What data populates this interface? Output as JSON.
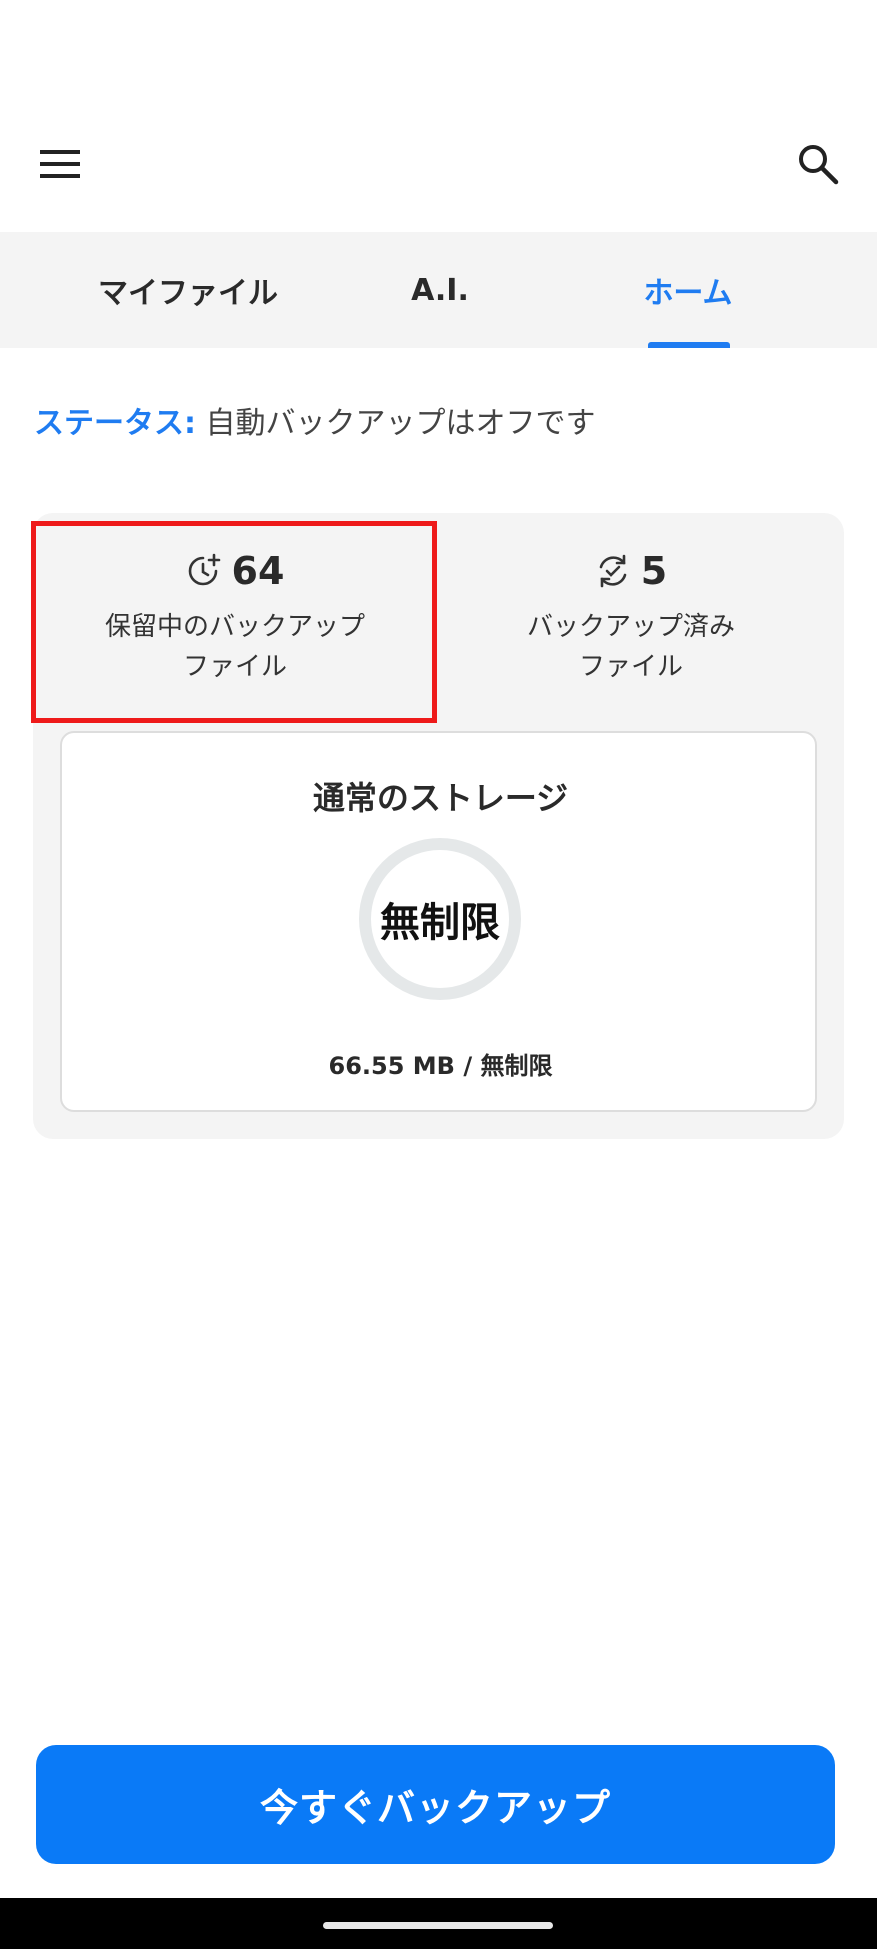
{
  "top_bar": {
    "menu_icon": "hamburger-menu-icon",
    "search_icon": "search-icon"
  },
  "tabs": [
    {
      "label": "マイファイル",
      "active": false
    },
    {
      "label": "A.I.",
      "active": false
    },
    {
      "label": "ホーム",
      "active": true
    }
  ],
  "status": {
    "key": "ステータス:",
    "value": "自動バックアップはオフです"
  },
  "stats": {
    "pending": {
      "count": "64",
      "label_line1": "保留中のバックアップ",
      "label_line2": "ファイル",
      "icon": "clock-plus-icon"
    },
    "backed_up": {
      "count": "5",
      "label_line1": "バックアップ済み",
      "label_line2": "ファイル",
      "icon": "sync-check-icon"
    }
  },
  "storage": {
    "title": "通常のストレージ",
    "ring_text": "無制限",
    "usage": "66.55 MB / 無制限"
  },
  "backup_button": {
    "label": "今すぐバックアップ"
  },
  "colors": {
    "accent": "#1f7cf1",
    "button": "#0a7af7",
    "highlight_frame": "#ee1a1a",
    "panel_bg": "#f4f4f4",
    "ring": "#e5e8e9"
  }
}
